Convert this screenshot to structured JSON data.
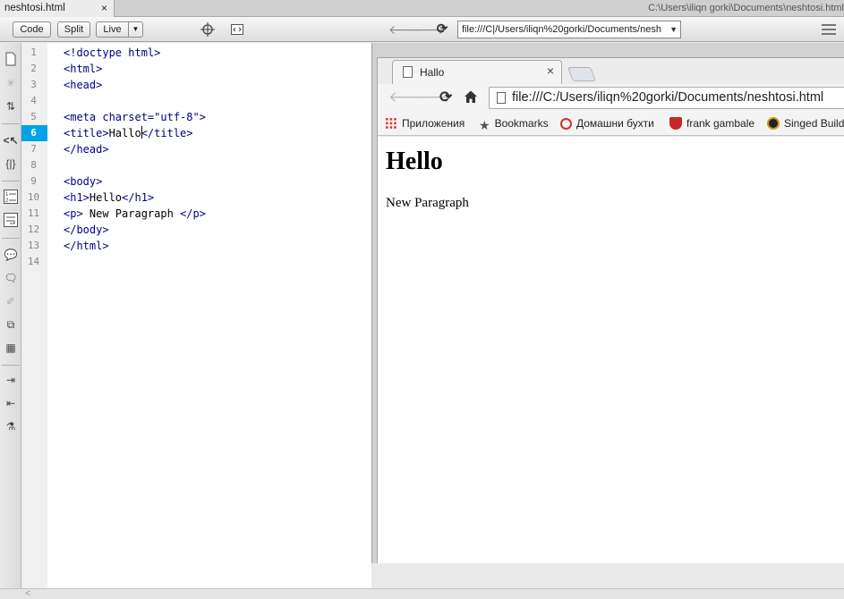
{
  "document_tab": {
    "title": "neshtosi.html",
    "close": "×"
  },
  "window_path": "C:\\Users\\iliqn gorki\\Documents\\neshtosi.html",
  "toolbar": {
    "code_label": "Code",
    "split_label": "Split",
    "live_label": "Live",
    "live_dropdown": "▼",
    "address": "file:///C|/Users/iliqn%20gorki/Documents/nesh",
    "address_dropdown": "▼"
  },
  "code": {
    "line_numbers": [
      "1",
      "2",
      "3",
      "4",
      "5",
      "6",
      "7",
      "8",
      "9",
      "10",
      "11",
      "12",
      "13",
      "14"
    ],
    "active_line": "6",
    "lines": {
      "l1": "<!doctype html>",
      "l2": "<html>",
      "l3": "<head>",
      "l5_tag": "<meta charset=",
      "l5_str": "\"utf-8\"",
      "l5_end": ">",
      "l6_open": "<title>",
      "l6_text": "Hallo",
      "l6_close": "</title>",
      "l7": "</head>",
      "l9": "<body>",
      "l10_open": "<h1>",
      "l10_text": "Hello",
      "l10_close": "</h1>",
      "l11_open": "<p>",
      "l11_text": " New Paragraph ",
      "l11_close": "</p>",
      "l12": "</body>",
      "l13": "</html>"
    }
  },
  "browser": {
    "tab_title": "Hallo",
    "tab_close": "×",
    "url": "file:///C:/Users/iliqn%20gorki/Documents/neshtosi.html",
    "bookmarks": {
      "apps": "Приложения",
      "bookmarks": "Bookmarks",
      "home": "Домашни бухти",
      "frank": "frank gambale",
      "singed": "Singed Build"
    },
    "page": {
      "heading": "Hello",
      "paragraph": "New Paragraph"
    }
  },
  "colors": {
    "active_line_bg": "#00a2e8",
    "tag_color": "#000080"
  }
}
